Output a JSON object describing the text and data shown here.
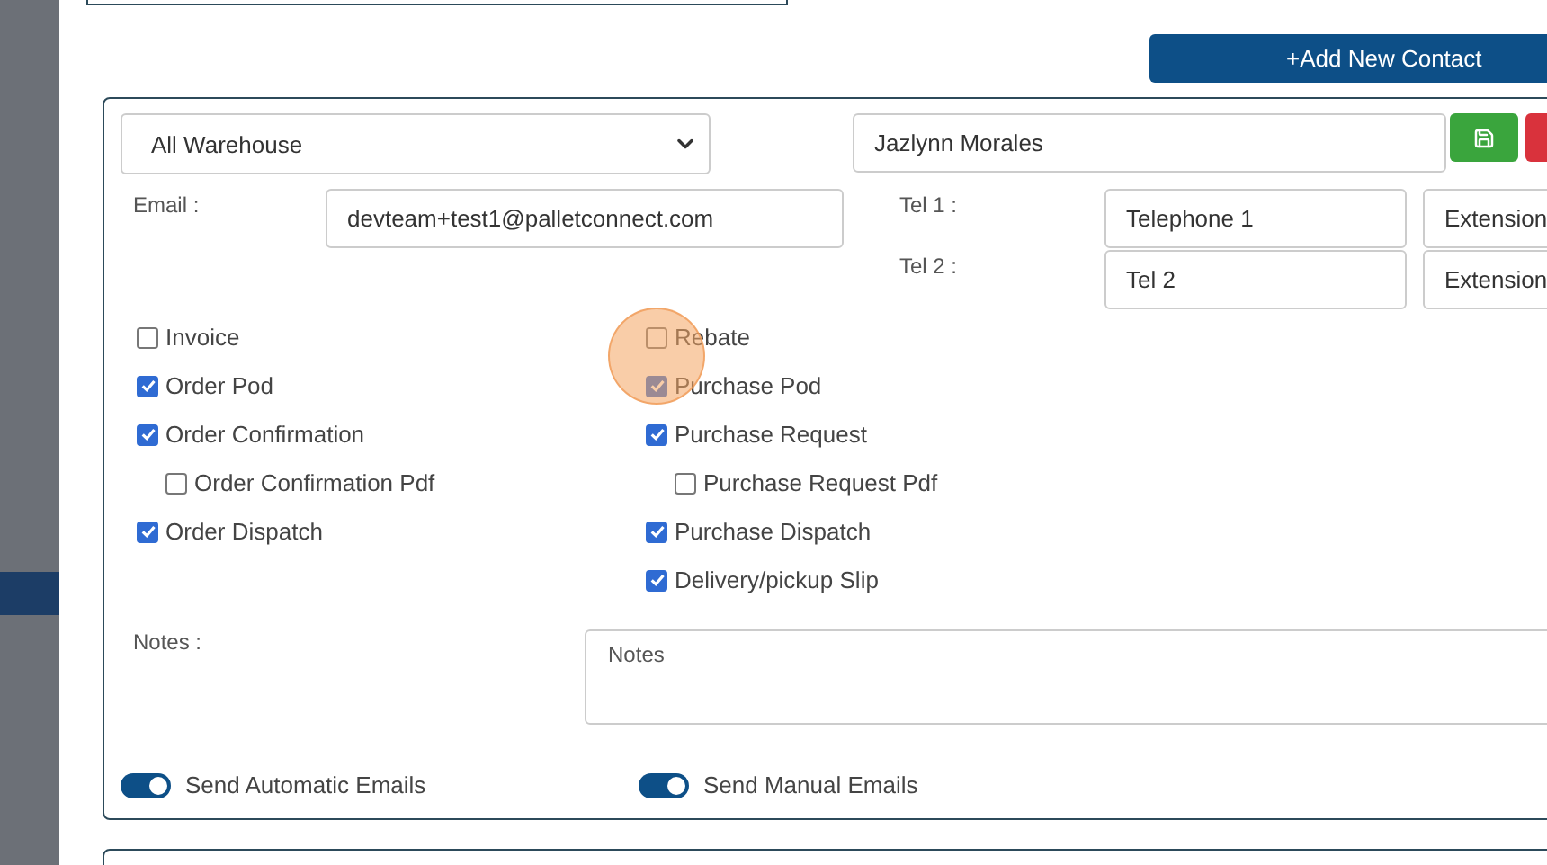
{
  "header_button": "+Add New Contact",
  "contact": {
    "warehouse": "All Warehouse",
    "name": "Jazlynn Morales",
    "email_label": "Email :",
    "email": "devteam+test1@palletconnect.com",
    "phones": [
      {
        "label": "Tel 1 :",
        "placeholder": "Telephone 1",
        "extension_placeholder": "Extension"
      },
      {
        "label": "Tel 2 :",
        "placeholder": "Tel 2",
        "extension_placeholder": "Extension"
      }
    ]
  },
  "notifications": {
    "left": [
      {
        "label": "Invoice",
        "checked": false
      },
      {
        "label": "Order Pod",
        "checked": true
      },
      {
        "label": "Order Confirmation",
        "checked": true,
        "children": [
          {
            "label": "Order Confirmation Pdf",
            "checked": false
          }
        ]
      },
      {
        "label": "Order Dispatch",
        "checked": true
      }
    ],
    "right": [
      {
        "label": "Rebate",
        "checked": false
      },
      {
        "label": "Purchase Pod",
        "checked": true
      },
      {
        "label": "Purchase Request",
        "checked": true,
        "children": [
          {
            "label": "Purchase Request Pdf",
            "checked": false
          }
        ]
      },
      {
        "label": "Purchase Dispatch",
        "checked": true
      },
      {
        "label": "Delivery/pickup Slip",
        "checked": true
      }
    ]
  },
  "notes": {
    "label": "Notes :",
    "placeholder": "Notes"
  },
  "toggles": [
    {
      "label": "Send Automatic Emails",
      "on": true
    },
    {
      "label": "Send Manual Emails",
      "on": true
    }
  ]
}
